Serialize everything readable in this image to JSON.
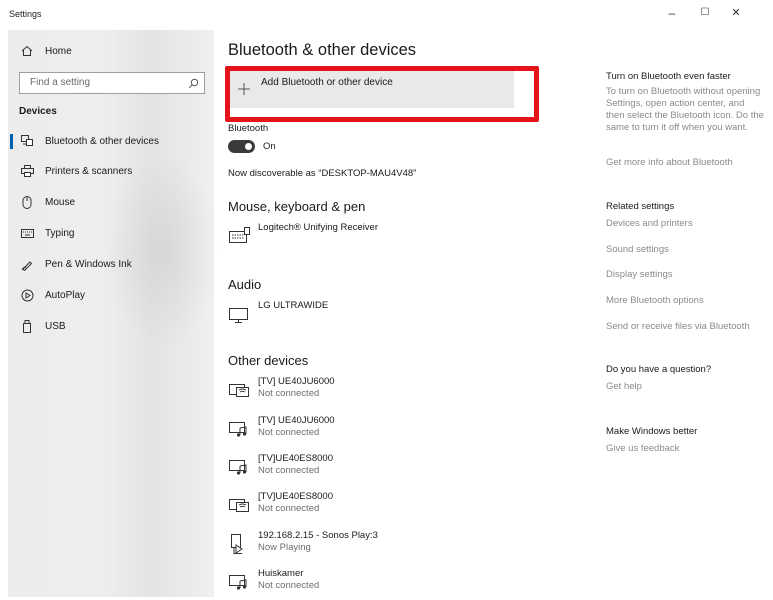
{
  "window": {
    "title": "Settings",
    "minimize": "–",
    "maximize": "☐",
    "close": "✕"
  },
  "sidebar": {
    "home": "Home",
    "search_placeholder": "Find a setting",
    "section": "Devices",
    "items": [
      {
        "label": "Bluetooth & other devices",
        "icon": "bluetooth-devices-icon"
      },
      {
        "label": "Printers & scanners",
        "icon": "printer-icon"
      },
      {
        "label": "Mouse",
        "icon": "mouse-icon"
      },
      {
        "label": "Typing",
        "icon": "keyboard-icon"
      },
      {
        "label": "Pen & Windows Ink",
        "icon": "pen-icon"
      },
      {
        "label": "AutoPlay",
        "icon": "autoplay-icon"
      },
      {
        "label": "USB",
        "icon": "usb-icon"
      }
    ]
  },
  "main": {
    "title": "Bluetooth & other devices",
    "add_device": "Add Bluetooth or other device",
    "bluetooth_label": "Bluetooth",
    "bluetooth_state": "On",
    "discoverable": "Now discoverable as “DESKTOP-MAU4V48”",
    "mouse_section": "Mouse, keyboard & pen",
    "mouse_devices": [
      {
        "name": "Logitech® Unifying Receiver",
        "icon": "keyboard-device-icon"
      }
    ],
    "audio_section": "Audio",
    "audio_devices": [
      {
        "name": "LG ULTRAWIDE",
        "icon": "monitor-icon"
      }
    ],
    "other_section": "Other devices",
    "other_devices": [
      {
        "name": "[TV] UE40JU6000",
        "status": "Not connected",
        "icon": "network-tv-icon"
      },
      {
        "name": "[TV] UE40JU6000",
        "status": "Not connected",
        "icon": "media-device-icon"
      },
      {
        "name": "[TV]UE40ES8000",
        "status": "Not connected",
        "icon": "media-device-icon"
      },
      {
        "name": "[TV]UE40ES8000",
        "status": "Not connected",
        "icon": "network-tv-icon"
      },
      {
        "name": "192.168.2.15 - Sonos Play:3",
        "status": "Now Playing",
        "icon": "speaker-play-icon"
      },
      {
        "name": "Huiskamer",
        "status": "Not connected",
        "icon": "media-device-icon"
      }
    ]
  },
  "right": {
    "faster_head": "Turn on Bluetooth even faster",
    "faster_text": "To turn on Bluetooth without opening Settings, open action center, and then select the Bluetooth icon. Do the same to turn it off when you want.",
    "faster_link": "Get more info about Bluetooth",
    "related_head": "Related settings",
    "related_links": [
      "Devices and printers",
      "Sound settings",
      "Display settings",
      "More Bluetooth options",
      "Send or receive files via Bluetooth"
    ],
    "question_head": "Do you have a question?",
    "question_link": "Get help",
    "better_head": "Make Windows better",
    "better_link": "Give us feedback"
  }
}
